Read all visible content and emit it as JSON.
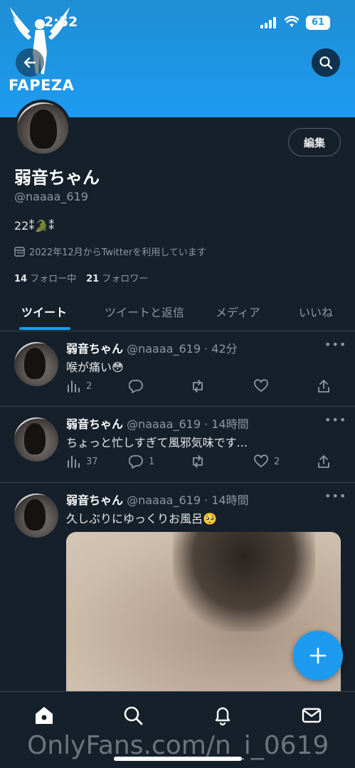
{
  "status_bar": {
    "time": "2:52",
    "battery": "61"
  },
  "watermark": {
    "logo_text": "FAPEZA",
    "bottom_text": "OnlyFans.com/n_i_0619"
  },
  "profile": {
    "edit_label": "編集",
    "display_name": "弱音ちゃん",
    "handle": "@naaaa_619",
    "bio": "22⁑🐊⁑",
    "joined": "2022年12月からTwitterを利用しています",
    "following_count": "14",
    "following_label": "フォロー中",
    "followers_count": "21",
    "followers_label": "フォロワー"
  },
  "tabs": [
    {
      "label": "ツイート",
      "active": true
    },
    {
      "label": "ツイートと返信",
      "active": false
    },
    {
      "label": "メディア",
      "active": false
    },
    {
      "label": "いいね",
      "active": false
    }
  ],
  "tweets": [
    {
      "name": "弱音ちゃん",
      "meta": "@naaaa_619 · 42分",
      "text": "喉が痛い😳",
      "views": "2",
      "replies": "",
      "retweets": "",
      "likes": ""
    },
    {
      "name": "弱音ちゃん",
      "meta": "@naaaa_619 · 14時間",
      "text": "ちょっと忙しすぎて風邪気味です...",
      "views": "37",
      "replies": "1",
      "retweets": "",
      "likes": "2"
    },
    {
      "name": "弱音ちゃん",
      "meta": "@naaaa_619 · 14時間",
      "text": "久しぶりにゆっくりお風呂🥺",
      "views": "",
      "replies": "",
      "retweets": "",
      "likes": ""
    }
  ],
  "colors": {
    "accent": "#1d9bf0",
    "background": "#15202b",
    "muted": "#8b98a5",
    "divider": "#38444d"
  },
  "icons": [
    "back-arrow-icon",
    "search-icon",
    "calendar-icon",
    "views-icon",
    "reply-icon",
    "retweet-icon",
    "like-icon",
    "share-icon",
    "compose-icon",
    "home-icon",
    "explore-icon",
    "notifications-icon",
    "messages-icon"
  ]
}
